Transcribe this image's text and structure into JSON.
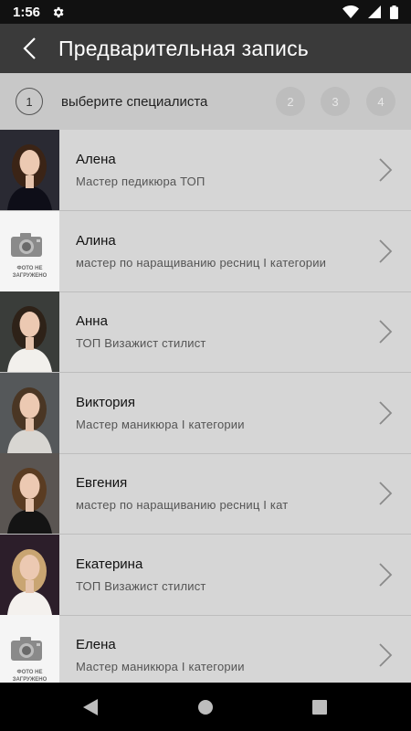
{
  "status": {
    "time": "1:56"
  },
  "header": {
    "title": "Предварительная запись"
  },
  "steps": {
    "current": "1",
    "current_label": "выберите специалиста",
    "others": [
      "2",
      "3",
      "4"
    ]
  },
  "placeholder_photo": {
    "line1": "ФОТО НЕ",
    "line2": "ЗАГРУЖЕНО"
  },
  "specialists": [
    {
      "name": "Алена",
      "role": "Мастер педикюра ТОП",
      "photo": "portrait-dark-dress",
      "bg": "#2a2a33",
      "hair": "#3b2416",
      "top": "#0e0e18",
      "has_photo": true
    },
    {
      "name": "Алина",
      "role": "мастер по наращиванию ресниц I категории",
      "photo": "photo-placeholder",
      "has_photo": false
    },
    {
      "name": "Анна",
      "role": "ТОП Визажист стилист",
      "photo": "portrait-white-blouse",
      "bg": "#3a3d3a",
      "hair": "#2e2218",
      "top": "#f2f0ec",
      "has_photo": true
    },
    {
      "name": "Виктория",
      "role": "Мастер маникюра I категории",
      "photo": "portrait-grey-top",
      "bg": "#55585a",
      "hair": "#4a3624",
      "top": "#d8d6d2",
      "has_photo": true
    },
    {
      "name": "Евгения",
      "role": "мастер по наращиванию ресниц I кат",
      "photo": "portrait-black-dress",
      "bg": "#5a5552",
      "hair": "#5a3c22",
      "top": "#141414",
      "has_photo": true
    },
    {
      "name": "Екатерина",
      "role": "ТОП Визажист стилист",
      "photo": "portrait-blonde",
      "bg": "#2c1e2a",
      "hair": "#c9a572",
      "top": "#f4f1ee",
      "has_photo": true
    },
    {
      "name": "Елена",
      "role": "Мастер маникюра I категории",
      "photo": "photo-placeholder",
      "has_photo": false
    }
  ]
}
